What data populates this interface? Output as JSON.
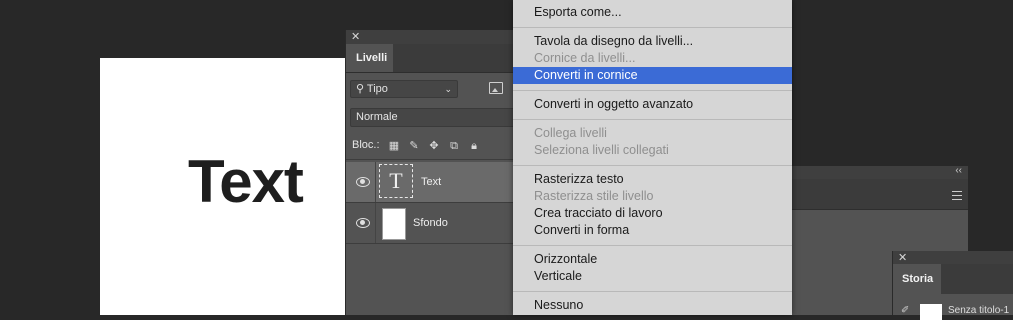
{
  "document": {
    "text": "Text"
  },
  "layers_panel": {
    "close": "✕",
    "tab": "Livelli",
    "filter_label": "Tipo",
    "blend_mode": "Normale",
    "lock_label": "Bloc.:",
    "layers": [
      {
        "name": "Text",
        "thumb": "T",
        "selected": true
      },
      {
        "name": "Sfondo",
        "selected": false
      }
    ]
  },
  "history_panel": {
    "close": "✕",
    "tab": "Storia",
    "item_label": "Senza titolo-1"
  },
  "right_panel": {
    "collapse": "‹‹"
  },
  "menu": {
    "items": [
      {
        "label": "Esporta come...",
        "state": "normal"
      },
      {
        "label": "Tavola da disegno da livelli...",
        "state": "normal"
      },
      {
        "label": "Cornice da livelli...",
        "state": "disabled"
      },
      {
        "label": "Converti in cornice",
        "state": "highlight"
      },
      {
        "label": "Converti in oggetto avanzato",
        "state": "normal"
      },
      {
        "label": "Collega livelli",
        "state": "disabled"
      },
      {
        "label": "Seleziona livelli collegati",
        "state": "disabled"
      },
      {
        "label": "Rasterizza testo",
        "state": "normal"
      },
      {
        "label": "Rasterizza stile livello",
        "state": "disabled"
      },
      {
        "label": "Crea tracciato di lavoro",
        "state": "normal"
      },
      {
        "label": "Converti in forma",
        "state": "normal"
      },
      {
        "label": "Orizzontale",
        "state": "normal"
      },
      {
        "label": "Verticale",
        "state": "normal"
      },
      {
        "label": "Nessuno",
        "state": "normal"
      }
    ]
  },
  "colors": {
    "highlight": "#3b6bd6",
    "app_background": "#282828",
    "panel": "#535353"
  }
}
